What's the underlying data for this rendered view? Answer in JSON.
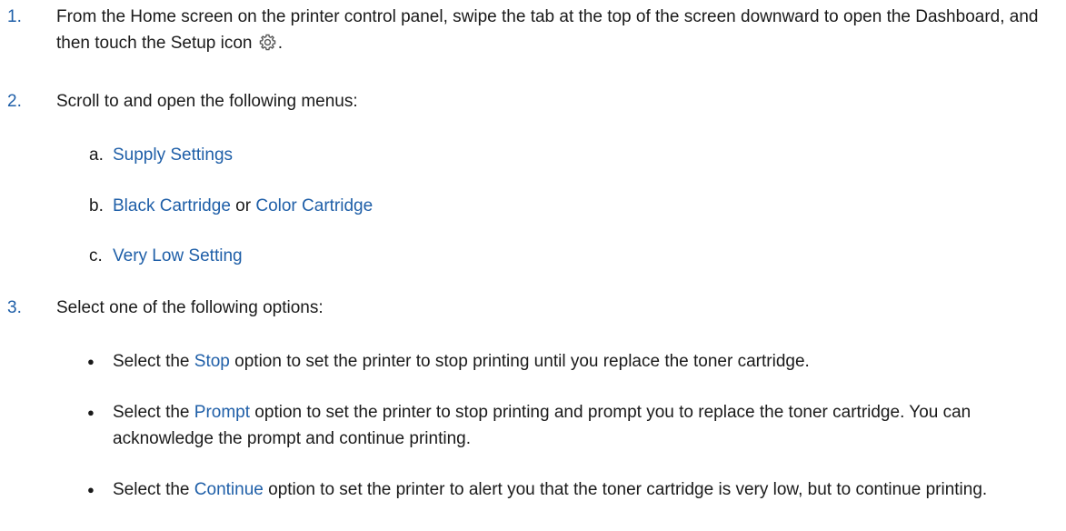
{
  "steps": [
    {
      "number": "1.",
      "text_part1": "From the Home screen on the printer control panel, swipe the tab at the top of the screen downward to open the Dashboard, and then touch the Setup icon",
      "text_part2": ".",
      "icon": "gear-icon"
    },
    {
      "number": "2.",
      "text": "Scroll to and open the following menus:",
      "substeps": [
        {
          "letter": "a.",
          "parts": [
            {
              "text": "Supply Settings",
              "link": true
            }
          ]
        },
        {
          "letter": "b.",
          "parts": [
            {
              "text": "Black Cartridge",
              "link": true
            },
            {
              "text": " or ",
              "link": false
            },
            {
              "text": "Color Cartridge",
              "link": true
            }
          ]
        },
        {
          "letter": "c.",
          "parts": [
            {
              "text": "Very Low Setting",
              "link": true
            }
          ]
        }
      ]
    },
    {
      "number": "3.",
      "text": "Select one of the following options:",
      "bullets": [
        {
          "marker": "●",
          "pre": "Select the ",
          "option": "Stop",
          "post": " option to set the printer to stop printing until you replace the toner cartridge."
        },
        {
          "marker": "●",
          "pre": "Select the ",
          "option": "Prompt",
          "post": " option to set the printer to stop printing and prompt you to replace the toner cartridge. You can acknowledge the prompt and continue printing."
        },
        {
          "marker": "●",
          "pre": "Select the ",
          "option": "Continue",
          "post": " option to set the printer to alert you that the toner cartridge is very low, but to continue printing."
        }
      ]
    }
  ],
  "colors": {
    "accent": "#1f5fa8",
    "text": "#1a1a1a"
  }
}
